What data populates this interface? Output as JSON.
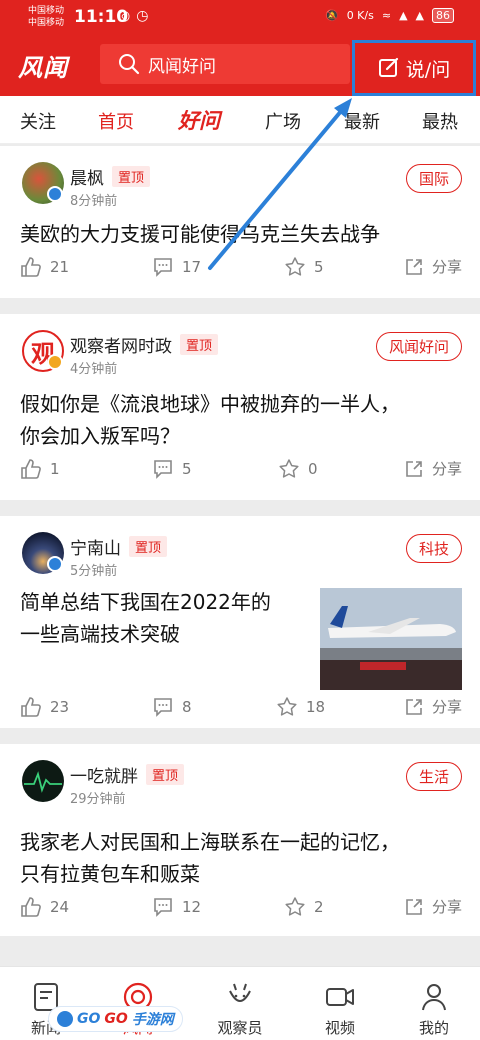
{
  "status": {
    "carrier1": "中国移动",
    "carrier2": "中国移动",
    "time": "11:10",
    "net_speed": "0 K/s",
    "battery": "86"
  },
  "header": {
    "logo": "风闻",
    "search_placeholder": "风闻好问",
    "ask_label": "说/问"
  },
  "tabs": [
    {
      "label": "关注"
    },
    {
      "label": "首页"
    },
    {
      "label": "好问"
    },
    {
      "label": "广场"
    },
    {
      "label": "最新"
    },
    {
      "label": "最热"
    }
  ],
  "posts": [
    {
      "author": "晨枫",
      "pin": "置顶",
      "time": "8分钟前",
      "tag": "国际",
      "title": "美欧的大力支援可能使得乌克兰失去战争",
      "likes": "21",
      "comments": "17",
      "favs": "5",
      "share": "分享"
    },
    {
      "author": "观察者网时政",
      "pin": "置顶",
      "time": "4分钟前",
      "tag": "风闻好问",
      "title_line1": "假如你是《流浪地球》中被抛弃的一半人，",
      "title_line2": "你会加入叛军吗？",
      "likes": "1",
      "comments": "5",
      "favs": "0",
      "share": "分享"
    },
    {
      "author": "宁南山",
      "pin": "置顶",
      "time": "5分钟前",
      "tag": "科技",
      "title_line1": "简单总结下我国在2022年的",
      "title_line2": "一些高端技术突破",
      "likes": "23",
      "comments": "8",
      "favs": "18",
      "share": "分享"
    },
    {
      "author": "一吃就胖",
      "pin": "置顶",
      "time": "29分钟前",
      "tag": "生活",
      "title_line1": "我家老人对民国和上海联系在一起的记忆，",
      "title_line2": "只有拉黄包车和贩菜",
      "likes": "24",
      "comments": "12",
      "favs": "2",
      "share": "分享"
    }
  ],
  "bottom_nav": [
    {
      "label": "新闻"
    },
    {
      "label": "风闻"
    },
    {
      "label": "观察员"
    },
    {
      "label": "视频"
    },
    {
      "label": "我的"
    }
  ],
  "watermark": {
    "text1": "GO",
    "text2": "GO",
    "text3": "手游网"
  },
  "colors": {
    "brand_red": "#e0231f",
    "annotation_blue": "#2c80d8"
  }
}
